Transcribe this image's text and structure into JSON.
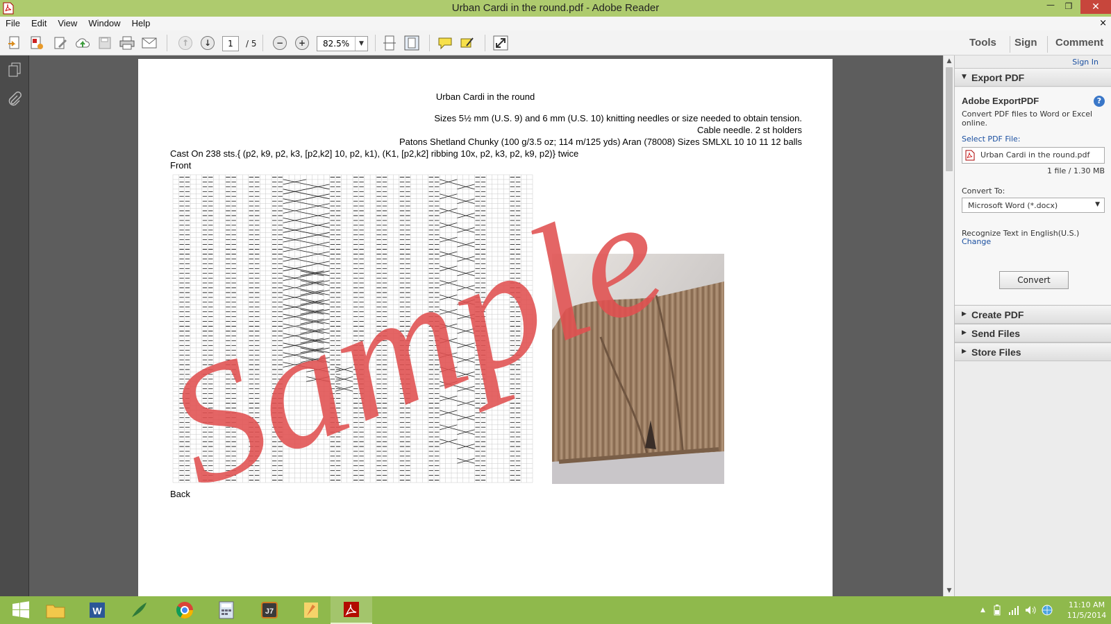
{
  "window": {
    "title": "Urban Cardi in the round.pdf - Adobe Reader",
    "minimize": "—",
    "restore": "❐",
    "close": "✕"
  },
  "menu": {
    "items": [
      "File",
      "Edit",
      "View",
      "Window",
      "Help"
    ],
    "close": "×"
  },
  "toolbar": {
    "page_current": "1",
    "page_total": "/ 5",
    "zoom": "82.5%",
    "tools_label": "Tools",
    "sign_label": "Sign",
    "comment_label": "Comment",
    "icons": [
      "create-pdf-icon",
      "export-pdf-icon",
      "edit-pdf-icon",
      "upload-cloud-icon",
      "save-icon",
      "print-icon",
      "email-icon",
      "previous-page-icon",
      "next-page-icon",
      "zoom-out-icon",
      "zoom-in-icon",
      "fit-width-icon",
      "fit-page-icon",
      "comment-icon",
      "highlight-icon",
      "full-screen-icon"
    ]
  },
  "document": {
    "title": "Urban Cardi in the round",
    "lines": [
      "Sizes 5½ mm (U.S. 9) and 6 mm (U.S. 10) knitting needles or size needed to obtain tension.",
      "Cable needle. 2 st holders",
      "Patons Shetland Chunky (100 g/3.5 oz; 114 m/125 yds) Aran (78008) Sizes SMLXL 10 10 11 12 balls"
    ],
    "cast_on": "Cast On 238 sts.{ (p2, k9, p2, k3, [p2,k2] 10, p2, k1), (K1, [p2,k2] ribbing 10x, p2, k3, p2, k9, p2)} twice",
    "front_label": "Front",
    "back_label": "Back",
    "watermark": "Sample"
  },
  "right_pane": {
    "sign_in": "Sign In",
    "export_header": "Export PDF",
    "export_title": "Adobe ExportPDF",
    "help": "?",
    "export_desc": "Convert PDF files to Word or Excel online.",
    "select_label": "Select PDF File:",
    "file_name": "Urban Cardi in the round.pdf",
    "file_size": "1 file / 1.30 MB",
    "convert_to_label": "Convert To:",
    "convert_to_value": "Microsoft Word (*.docx)",
    "recognize_text": "Recognize Text in English(U.S.)",
    "change_link": "Change",
    "convert_button": "Convert",
    "sections": [
      "Create PDF",
      "Send Files",
      "Store Files"
    ]
  },
  "taskbar": {
    "apps": [
      "start-icon",
      "file-explorer-icon",
      "word-icon",
      "quill-icon",
      "chrome-icon",
      "calculator-icon",
      "app-icon",
      "paint-icon",
      "adobe-reader-icon"
    ],
    "time": "11:10 AM",
    "date": "11/5/2014",
    "tray_up": "▲"
  },
  "colors": {
    "titlebar": "#aecb6e",
    "taskbar": "#8fb94c",
    "close": "#c7463c",
    "watermark": "#e05050",
    "link": "#1a4fa0"
  }
}
